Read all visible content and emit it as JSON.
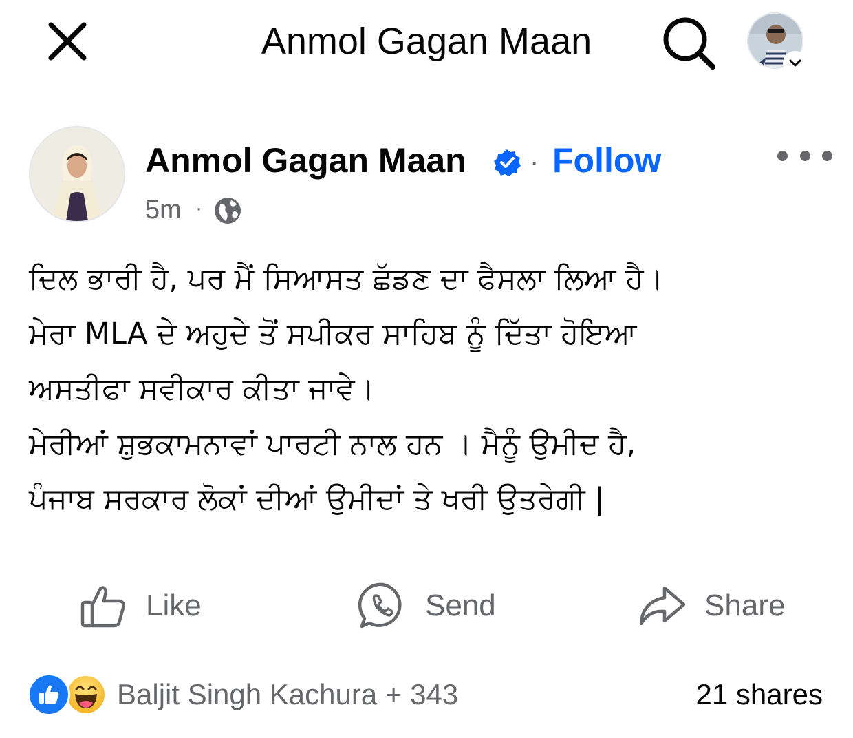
{
  "header": {
    "title": "Anmol Gagan Maan"
  },
  "post": {
    "author": "Anmol Gagan Maan",
    "follow_label": "Follow",
    "dot_separator": "·",
    "timestamp": "5m",
    "time_separator": "·",
    "audience_icon": "globe-icon",
    "body_lines": [
      "ਦਿਲ ਭਾਰੀ ਹੈ, ਪਰ ਮੈਂ ਸਿਆਸਤ ਛੱਡਣ ਦਾ ਫੈਸਲਾ ਲਿਆ ਹੈ।",
      "ਮੇਰਾ MLA ਦੇ ਅਹੁਦੇ ਤੋਂ ਸਪੀਕਰ ਸਾਹਿਬ ਨੂੰ ਦਿੱਤਾ ਹੋਇਆ",
      "ਅਸਤੀਫਾ ਸਵੀਕਾਰ ਕੀਤਾ ਜਾਵੇ।",
      "ਮੇਰੀਆਂ ਸ਼ੁਭਕਾਮਨਾਵਾਂ ਪਾਰਟੀ ਨਾਲ ਹਨ । ਮੈਨੂੰ ਉਮੀਦ ਹੈ,",
      "ਪੰਜਾਬ ਸਰਕਾਰ ਲੋਕਾਂ ਦੀਆਂ ਉਮੀਦਾਂ ਤੇ ਖਰੀ ਉਤਰੇਗੀ |"
    ]
  },
  "actions": {
    "like_label": "Like",
    "send_label": "Send",
    "share_label": "Share"
  },
  "footer": {
    "reactors": "Baljit Singh Kachura + 343",
    "shares": "21 shares"
  },
  "colors": {
    "brand_blue": "#0866ff",
    "secondary_text": "#65676b",
    "primary_text": "#050505"
  }
}
